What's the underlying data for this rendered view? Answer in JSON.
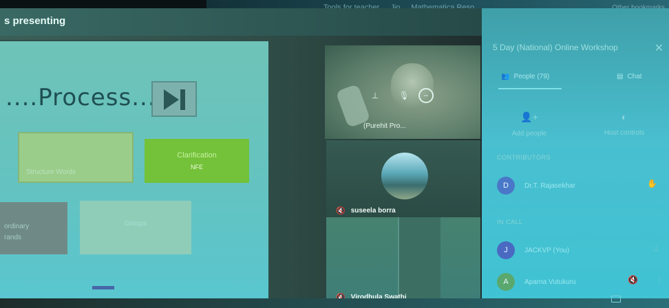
{
  "browser": {
    "bookmarks": [
      "Tools for teacher",
      "Jio",
      "Mathematica Reso"
    ],
    "other_bookmarks": "Other bookmarks"
  },
  "meet": {
    "presenting_label": "s presenting",
    "slide": {
      "title": "....Process...",
      "box_a_text": "Structure Words",
      "box_b_title": "Clarification",
      "box_b_sub": "NFE",
      "box_c_lines": [
        "ordinary",
        "rands"
      ],
      "box_d_text": "Groups"
    },
    "participants": [
      {
        "name": "(Purehit Pro...",
        "mic_icon": "mic-icon"
      },
      {
        "name": "suseela borra",
        "mic_icon": "mic-off-icon"
      },
      {
        "name": "Virodhula Swathi",
        "mic_icon": "mic-off-icon"
      }
    ],
    "tile_controls": [
      "pin-icon",
      "mic-icon",
      "minus-circle-icon"
    ]
  },
  "panel": {
    "title": "5 Day (National) Online Workshop",
    "tabs": [
      {
        "label": "People (79)",
        "icon": "people-icon"
      },
      {
        "label": "Chat",
        "icon": "chat-icon"
      }
    ],
    "actions": [
      {
        "label": "Add people",
        "icon": "add-person-icon"
      },
      {
        "label": "Host controls",
        "icon": "toggle-icon"
      }
    ],
    "sections": {
      "contributors": "CONTRIBUTORS",
      "in_call": "IN CALL"
    },
    "people": [
      {
        "initial": "D",
        "name": "Dr.T. Rajasekhar",
        "color": "#4a78c8"
      },
      {
        "initial": "J",
        "name": "JACKVP (You)",
        "color": "#4a6ac2"
      },
      {
        "initial": "A",
        "name": "Aparna Vutukuru",
        "color": "#5aa86e"
      }
    ]
  },
  "colors": {
    "panel_bg": "#49bfd0",
    "slide_bg": "#64c3c0",
    "accent_green": "#74c13a"
  }
}
